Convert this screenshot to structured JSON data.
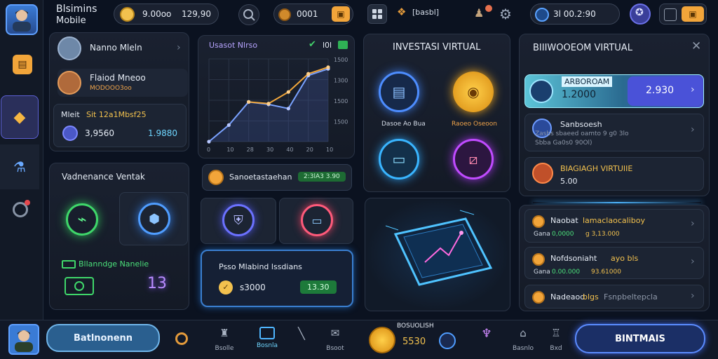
{
  "app": {
    "title": "Blsimins",
    "subtitle": "Mobile"
  },
  "topbar": {
    "coin_balance": "9.00oo",
    "coin_balance2": "129,90",
    "gem_balance": "0001",
    "chest_label": "[basbl]",
    "wallet_balance": "3l 00.2:90"
  },
  "profiles": [
    {
      "name": "Nanno Mleln"
    },
    {
      "name": "Flaiod Mneoo",
      "sub": "MODOOO3oo"
    }
  ],
  "mini_balance": {
    "title_prefix": "Mleit",
    "title_highlight": "Sit 12a1Mbsf25",
    "value_left": "3,9560",
    "value_right": "1.9880"
  },
  "left_panel": {
    "title": "Vadnenance Ventak",
    "bottom_label": "Bllanndge Nanelie",
    "bottom_number": "13"
  },
  "chart_panel": {
    "title": "Usasot Nlrso",
    "badge": "l0l",
    "y_ticks": [
      "1500",
      "1300",
      "1500",
      "1500"
    ],
    "x_ticks": [
      "0",
      "10",
      "28",
      "30",
      "40",
      "20",
      "10"
    ],
    "action_label": "Sanoetastaehan",
    "action_value": "2:3lA3 3.90"
  },
  "chart_data": {
    "type": "line",
    "title": "Usasot Nlrso",
    "x": [
      0,
      1,
      2,
      3,
      4,
      5,
      6
    ],
    "series": [
      {
        "color": "#7aa2ff",
        "values": [
          0,
          20,
          48,
          45,
          40,
          80,
          88
        ]
      },
      {
        "color": "#f2a73b",
        "values": [
          null,
          null,
          48,
          46,
          60,
          82,
          90
        ]
      }
    ],
    "ylim": [
      0,
      100
    ],
    "grid": true
  },
  "reward_card": {
    "title": "Psso Mlabind lssdians",
    "value": "s3000",
    "badge": "13.30"
  },
  "invest_panel": {
    "title": "INVESTASI VIRTUAL",
    "items": [
      {
        "label": "Dasoe Ao Bua",
        "color": "#4d8dff"
      },
      {
        "label": "Raoeo Oseoon",
        "color": "#f5a623"
      },
      {
        "label": "",
        "color": "#39b5ff"
      },
      {
        "label": "",
        "color": "#c04bff"
      }
    ]
  },
  "right_panel": {
    "title": "BIIIWOOEOM VIRTUAL",
    "highlight": {
      "label": "ARBOROAM",
      "value": "1.2000",
      "action": "2.930"
    },
    "row1": {
      "label": "Sanbsoesh",
      "sub1": "Zasbs sbaeed oamto 9 g0 3lo",
      "sub2": "Sbba Ga0s0 90Ol)"
    },
    "row2": {
      "label": "BIAGIAGH VIRTUIIE",
      "value": "5.00"
    }
  },
  "list_items": [
    {
      "title": "Naobat",
      "title_highlight": "lamaclaocaliboy",
      "sub_prefix": "Gana",
      "sub_green": "0,0000",
      "sub_gold": "g 3,13.000"
    },
    {
      "title": "Nofdsoniaht",
      "title_highlight": "ayo bls",
      "sub_prefix": "Gana",
      "sub_green": "0.00.000",
      "sub_gold": "93.61000"
    },
    {
      "title": "Nadeaod",
      "title_highlight": "blgs",
      "title_tail": "Fsnpbeltepcla",
      "sub_prefix": "",
      "sub_green": "",
      "sub_gold": ""
    }
  ],
  "bottombar": {
    "left_button": "Batlnonenn",
    "icons": [
      {
        "label": "Bsolle"
      },
      {
        "label": "Bosnla"
      },
      {
        "label": ""
      },
      {
        "label": "Bsoot"
      }
    ],
    "center_title": "BOSUOLISH",
    "center_value": "5530",
    "right_icons": [
      {
        "label": ""
      },
      {
        "label": "Basnlo"
      },
      {
        "label": "Bxd"
      }
    ],
    "right_button": "BINTMAIS"
  }
}
